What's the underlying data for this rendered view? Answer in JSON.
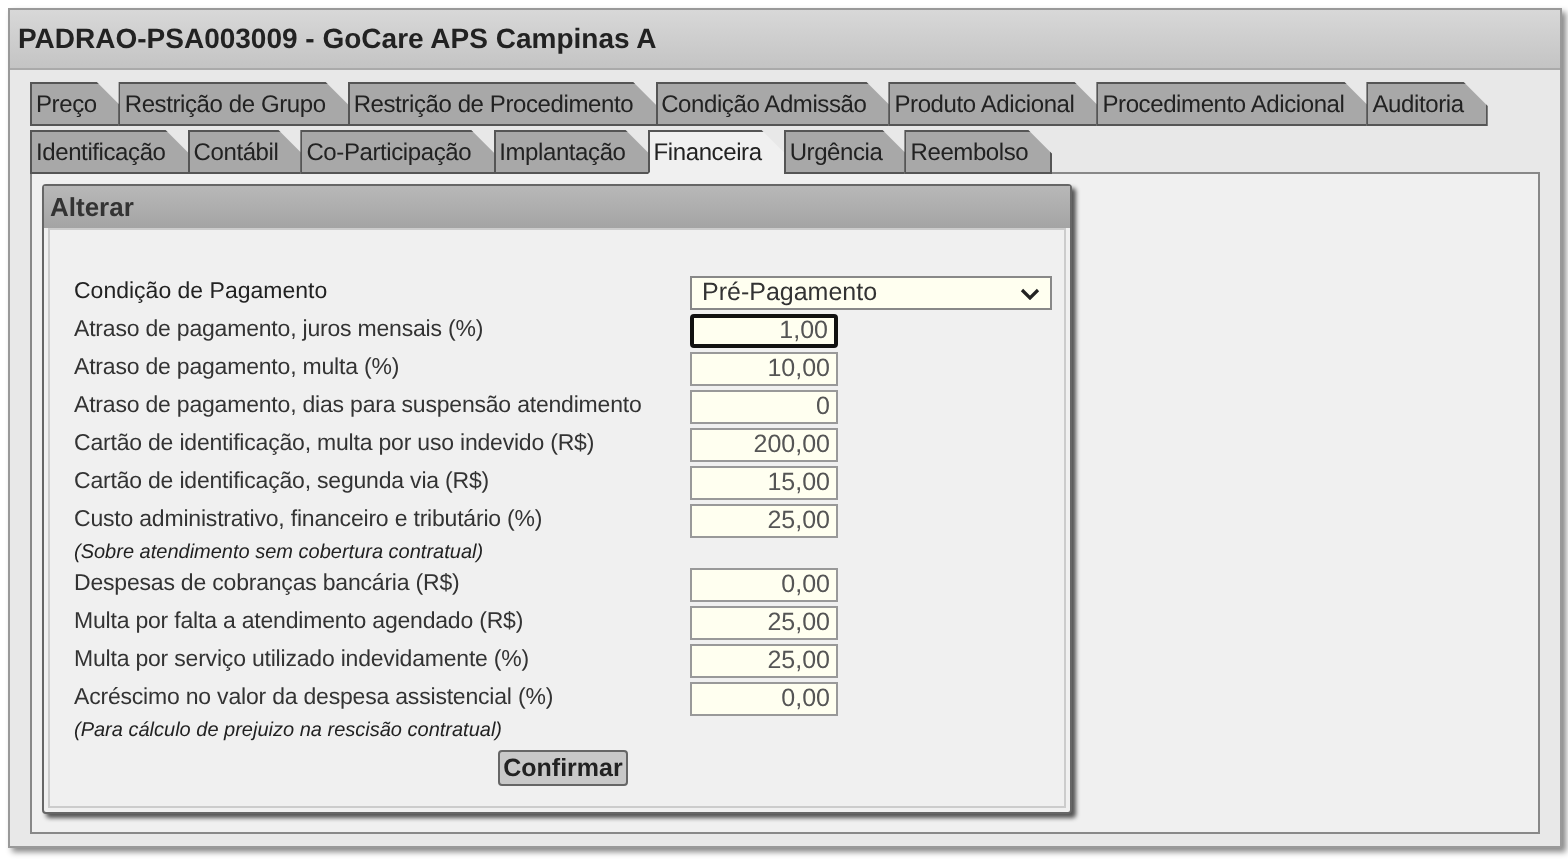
{
  "window": {
    "title": "PADRAO-PSA003009 - GoCare APS Campinas A"
  },
  "tab_rows": [
    [
      {
        "label": "Preço",
        "selected": false
      },
      {
        "label": "Restrição de Grupo",
        "selected": false
      },
      {
        "label": "Restrição de Procedimento",
        "selected": false
      },
      {
        "label": "Condição Admissão",
        "selected": false
      },
      {
        "label": "Produto Adicional",
        "selected": false
      },
      {
        "label": "Procedimento Adicional",
        "selected": false
      },
      {
        "label": "Auditoria",
        "selected": false
      }
    ],
    [
      {
        "label": "Identificação",
        "selected": false
      },
      {
        "label": "Contábil",
        "selected": false
      },
      {
        "label": "Co-Participação",
        "selected": false
      },
      {
        "label": "Implantação",
        "selected": false
      },
      {
        "label": "Financeira",
        "selected": true
      },
      {
        "label": "Urgência",
        "selected": false
      },
      {
        "label": "Reembolso",
        "selected": false
      }
    ]
  ],
  "dialog": {
    "title": "Alterar",
    "fields": [
      {
        "kind": "select",
        "label": "Condição de Pagamento",
        "value": "Pré-Pagamento"
      },
      {
        "kind": "number",
        "label": "Atraso de pagamento, juros mensais (%)",
        "value": "1,00",
        "focused": true
      },
      {
        "kind": "number",
        "label": "Atraso de pagamento, multa (%)",
        "value": "10,00",
        "focused": false
      },
      {
        "kind": "number",
        "label": "Atraso de pagamento, dias para suspensão atendimento",
        "value": "0",
        "focused": false
      },
      {
        "kind": "number",
        "label": "Cartão de identificação, multa por uso indevido (R$)",
        "value": "200,00",
        "focused": false
      },
      {
        "kind": "number",
        "label": "Cartão de identificação, segunda via (R$)",
        "value": "15,00",
        "focused": false
      },
      {
        "kind": "number",
        "label": "Custo administrativo, financeiro e tributário (%)",
        "value": "25,00",
        "focused": false
      },
      {
        "kind": "note",
        "label": "(Sobre atendimento sem cobertura contratual)"
      },
      {
        "kind": "number",
        "label": "Despesas de cobranças bancária (R$)",
        "value": "0,00",
        "focused": false
      },
      {
        "kind": "number",
        "label": "Multa por falta a atendimento agendado (R$)",
        "value": "25,00",
        "focused": false
      },
      {
        "kind": "number",
        "label": "Multa por serviço utilizado indevidamente (%)",
        "value": "25,00",
        "focused": false
      },
      {
        "kind": "number",
        "label": "Acréscimo no valor da despesa assistencial (%)",
        "value": "0,00",
        "focused": false
      },
      {
        "kind": "note",
        "label": "(Para cálculo de prejuizo na rescisão contratual)"
      }
    ],
    "button": "Confirmar"
  }
}
